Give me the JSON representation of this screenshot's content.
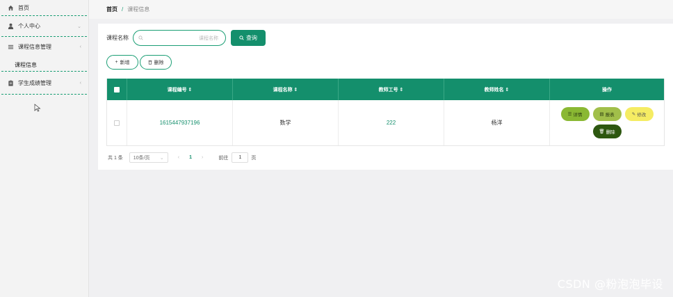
{
  "sidebar": {
    "items": [
      {
        "label": "首页",
        "icon": "home-icon"
      },
      {
        "label": "个人中心",
        "icon": "user-icon",
        "arrow": "⌄"
      },
      {
        "label": "课程信息管理",
        "icon": "menu-icon",
        "arrow": "‹",
        "children": [
          {
            "label": "课程信息"
          }
        ]
      },
      {
        "label": "学生成绩管理",
        "icon": "clipboard-icon",
        "arrow": "‹"
      }
    ]
  },
  "breadcrumb": {
    "home": "首页",
    "separator": "/",
    "current": "课程信息"
  },
  "search": {
    "label": "课程名称",
    "placeholder": "课程名称",
    "button": "查询"
  },
  "actions": {
    "add": "新增",
    "delete": "删除"
  },
  "table": {
    "columns": [
      "课程编号 ⇕",
      "课程名称 ⇕",
      "教师工号 ⇕",
      "教师姓名 ⇕",
      "操作"
    ],
    "rows": [
      {
        "course_id": "1615447937196",
        "course_name": "数学",
        "teacher_id": "222",
        "teacher_name": "杨洋"
      }
    ],
    "row_actions": {
      "detail": "详情",
      "report": "报表",
      "edit": "修改",
      "delete": "删除"
    }
  },
  "pagination": {
    "total": "共 1 条",
    "page_size": "10条/页",
    "prev": "‹",
    "current": "1",
    "next": "›",
    "goto_label": "前往",
    "goto_value": "1",
    "page_suffix": "页"
  },
  "watermark": "CSDN @粉泡泡毕设",
  "colors": {
    "primary": "#148f6c",
    "detail": "#8ab833",
    "report": "#a1bf4a",
    "edit": "#f5ec63",
    "delete": "#2d5710"
  }
}
